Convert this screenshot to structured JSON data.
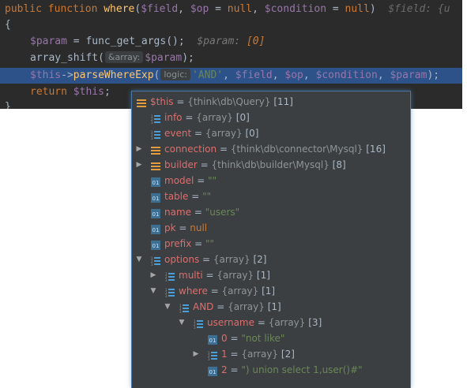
{
  "editor": {
    "line1": {
      "kw": "public function ",
      "fn": "where",
      "text_a": "(",
      "v_field": "$field",
      "text_b": ", ",
      "v_op": "$op",
      "text_c": " = ",
      "kw_null1": "null",
      "text_d": ", ",
      "v_condition": "$condition",
      "text_e": " = ",
      "kw_null2": "null",
      "text_f": ")  ",
      "hint": "$field: {u"
    },
    "line2": "{",
    "line3": {
      "v_param": "$param",
      "text_a": " = func_get_args();  ",
      "hint_var": "$param: ",
      "hint_val": "[0]"
    },
    "line4": {
      "text_a": "array_shift(",
      "inlay": "&array:",
      "v_param": "$param",
      "text_b": ");"
    },
    "line5": {
      "v_this": "$this",
      "arrow": "->",
      "fn": "parseWhereExp",
      "text_a": "(",
      "inlay": "logic:",
      "str": "'AND'",
      "text_b": ", ",
      "v_field": "$field",
      "text_c": ", ",
      "v_op": "$op",
      "text_d": ", ",
      "v_condition": "$condition",
      "text_e": ", ",
      "v_param": "$param",
      "text_f": ");"
    },
    "line6": {
      "kw": "return ",
      "v_this": "$this",
      "text_a": ";"
    },
    "line7": "}"
  },
  "popup": {
    "rows": [
      {
        "name": "$this",
        "type": "{think\\db\\Query}",
        "count": "[11]"
      },
      {
        "name": "info",
        "type": "{array}",
        "count": "[0]"
      },
      {
        "name": "event",
        "type": "{array}",
        "count": "[0]"
      },
      {
        "name": "connection",
        "type": "{think\\db\\connector\\Mysql}",
        "count": "[16]"
      },
      {
        "name": "builder",
        "type": "{think\\db\\builder\\Mysql}",
        "count": "[8]"
      },
      {
        "name": "model",
        "value": "\"\""
      },
      {
        "name": "table",
        "value": "\"\""
      },
      {
        "name": "name",
        "value": "\"users\""
      },
      {
        "name": "pk",
        "value": "null"
      },
      {
        "name": "prefix",
        "value": "\"\""
      },
      {
        "name": "options",
        "type": "{array}",
        "count": "[2]"
      },
      {
        "name": "multi",
        "type": "{array}",
        "count": "[1]"
      },
      {
        "name": "where",
        "type": "{array}",
        "count": "[1]"
      },
      {
        "name": "AND",
        "type": "{array}",
        "count": "[1]"
      },
      {
        "name": "username",
        "type": "{array}",
        "count": "[3]"
      },
      {
        "name": "0",
        "value": "\"not like\""
      },
      {
        "name": "1",
        "type": "{array}",
        "count": "[2]"
      },
      {
        "name": "2",
        "value": "\") union select 1,user()#\""
      }
    ],
    "eq": " = "
  },
  "icons": {
    "object": "object-icon",
    "array": "array-icon",
    "field": "field-icon",
    "expand": "expand-arrow-icon",
    "collapse": "collapse-arrow-icon"
  },
  "colors": {
    "editor_bg": "#2b2b2b",
    "current_line": "#2d5189",
    "popup_bg": "#3c3f41",
    "popup_border": "#4a78a8",
    "var_name": "#de6d6d",
    "string": "#6a8759",
    "keyword": "#cc7832",
    "function": "#ffc66d",
    "variable": "#9876aa"
  }
}
